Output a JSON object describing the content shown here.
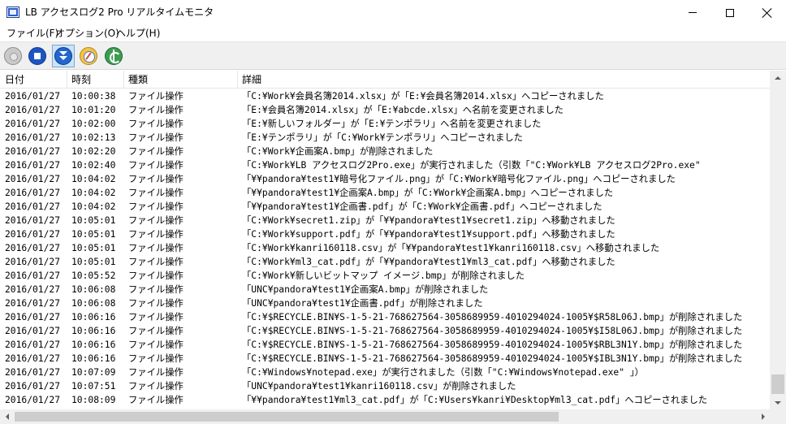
{
  "window": {
    "title": "LB アクセスログ2 Pro リアルタイムモニタ",
    "app_icon": "app-window-icon"
  },
  "menu": [
    {
      "label": "ファイル(F)"
    },
    {
      "label": "オプション(O)"
    },
    {
      "label": "ヘルプ(H)"
    }
  ],
  "toolbar": {
    "buttons": [
      {
        "name": "record",
        "icon": "record-disabled-icon",
        "pressed": false
      },
      {
        "name": "stop",
        "icon": "stop-icon",
        "pressed": false
      },
      {
        "name": "auto-scroll",
        "icon": "scroll-down-icon",
        "pressed": true
      },
      {
        "name": "compass",
        "icon": "compass-icon",
        "pressed": false
      },
      {
        "name": "sync",
        "icon": "sync-icon",
        "pressed": false
      }
    ]
  },
  "columns": {
    "date": "日付",
    "time": "時刻",
    "type": "種類",
    "detail": "詳細"
  },
  "rows": [
    {
      "date": "2016/01/27",
      "time": "10:00:38",
      "type": "ファイル操作",
      "detail": "「C:¥Work¥会員名簿2014.xlsx」が「E:¥会員名簿2014.xlsx」へコピーされました"
    },
    {
      "date": "2016/01/27",
      "time": "10:01:20",
      "type": "ファイル操作",
      "detail": "「E:¥会員名簿2014.xlsx」が「E:¥abcde.xlsx」へ名前を変更されました"
    },
    {
      "date": "2016/01/27",
      "time": "10:02:00",
      "type": "ファイル操作",
      "detail": "「E:¥新しいフォルダー」が「E:¥テンポラリ」へ名前を変更されました"
    },
    {
      "date": "2016/01/27",
      "time": "10:02:13",
      "type": "ファイル操作",
      "detail": "「E:¥テンポラリ」が「C:¥Work¥テンポラリ」へコピーされました"
    },
    {
      "date": "2016/01/27",
      "time": "10:02:20",
      "type": "ファイル操作",
      "detail": "「C:¥Work¥企画案A.bmp」が削除されました"
    },
    {
      "date": "2016/01/27",
      "time": "10:02:40",
      "type": "ファイル操作",
      "detail": "「C:¥Work¥LB アクセスログ2Pro.exe」が実行されました（引数「\"C:¥Work¥LB アクセスログ2Pro.exe\""
    },
    {
      "date": "2016/01/27",
      "time": "10:04:02",
      "type": "ファイル操作",
      "detail": "「¥¥pandora¥test1¥暗号化ファイル.png」が「C:¥Work¥暗号化ファイル.png」へコピーされました"
    },
    {
      "date": "2016/01/27",
      "time": "10:04:02",
      "type": "ファイル操作",
      "detail": "「¥¥pandora¥test1¥企画案A.bmp」が「C:¥Work¥企画案A.bmp」へコピーされました"
    },
    {
      "date": "2016/01/27",
      "time": "10:04:02",
      "type": "ファイル操作",
      "detail": "「¥¥pandora¥test1¥企画書.pdf」が「C:¥Work¥企画書.pdf」へコピーされました"
    },
    {
      "date": "2016/01/27",
      "time": "10:05:01",
      "type": "ファイル操作",
      "detail": "「C:¥Work¥secret1.zip」が「¥¥pandora¥test1¥secret1.zip」へ移動されました"
    },
    {
      "date": "2016/01/27",
      "time": "10:05:01",
      "type": "ファイル操作",
      "detail": "「C:¥Work¥support.pdf」が「¥¥pandora¥test1¥support.pdf」へ移動されました"
    },
    {
      "date": "2016/01/27",
      "time": "10:05:01",
      "type": "ファイル操作",
      "detail": "「C:¥Work¥kanri160118.csv」が「¥¥pandora¥test1¥kanri160118.csv」へ移動されました"
    },
    {
      "date": "2016/01/27",
      "time": "10:05:01",
      "type": "ファイル操作",
      "detail": "「C:¥Work¥ml3_cat.pdf」が「¥¥pandora¥test1¥ml3_cat.pdf」へ移動されました"
    },
    {
      "date": "2016/01/27",
      "time": "10:05:52",
      "type": "ファイル操作",
      "detail": "「C:¥Work¥新しいビットマップ イメージ.bmp」が削除されました"
    },
    {
      "date": "2016/01/27",
      "time": "10:06:08",
      "type": "ファイル操作",
      "detail": "「UNC¥pandora¥test1¥企画案A.bmp」が削除されました"
    },
    {
      "date": "2016/01/27",
      "time": "10:06:08",
      "type": "ファイル操作",
      "detail": "「UNC¥pandora¥test1¥企画書.pdf」が削除されました"
    },
    {
      "date": "2016/01/27",
      "time": "10:06:16",
      "type": "ファイル操作",
      "detail": "「C:¥$RECYCLE.BIN¥S-1-5-21-768627564-3058689959-4010294024-1005¥$R58L06J.bmp」が削除されました"
    },
    {
      "date": "2016/01/27",
      "time": "10:06:16",
      "type": "ファイル操作",
      "detail": "「C:¥$RECYCLE.BIN¥S-1-5-21-768627564-3058689959-4010294024-1005¥$I58L06J.bmp」が削除されました"
    },
    {
      "date": "2016/01/27",
      "time": "10:06:16",
      "type": "ファイル操作",
      "detail": "「C:¥$RECYCLE.BIN¥S-1-5-21-768627564-3058689959-4010294024-1005¥$RBL3N1Y.bmp」が削除されました"
    },
    {
      "date": "2016/01/27",
      "time": "10:06:16",
      "type": "ファイル操作",
      "detail": "「C:¥$RECYCLE.BIN¥S-1-5-21-768627564-3058689959-4010294024-1005¥$IBL3N1Y.bmp」が削除されました"
    },
    {
      "date": "2016/01/27",
      "time": "10:07:09",
      "type": "ファイル操作",
      "detail": "「C:¥Windows¥notepad.exe」が実行されました（引数「\"C:¥Windows¥notepad.exe\" 」）"
    },
    {
      "date": "2016/01/27",
      "time": "10:07:51",
      "type": "ファイル操作",
      "detail": "「UNC¥pandora¥test1¥kanri160118.csv」が削除されました"
    },
    {
      "date": "2016/01/27",
      "time": "10:08:09",
      "type": "ファイル操作",
      "detail": "「¥¥pandora¥test1¥ml3_cat.pdf」が「C:¥Users¥kanri¥Desktop¥ml3_cat.pdf」へコピーされました"
    }
  ],
  "scroll": {
    "vertical_position": 0.97,
    "horizontal_visible_fraction": 0.73
  }
}
